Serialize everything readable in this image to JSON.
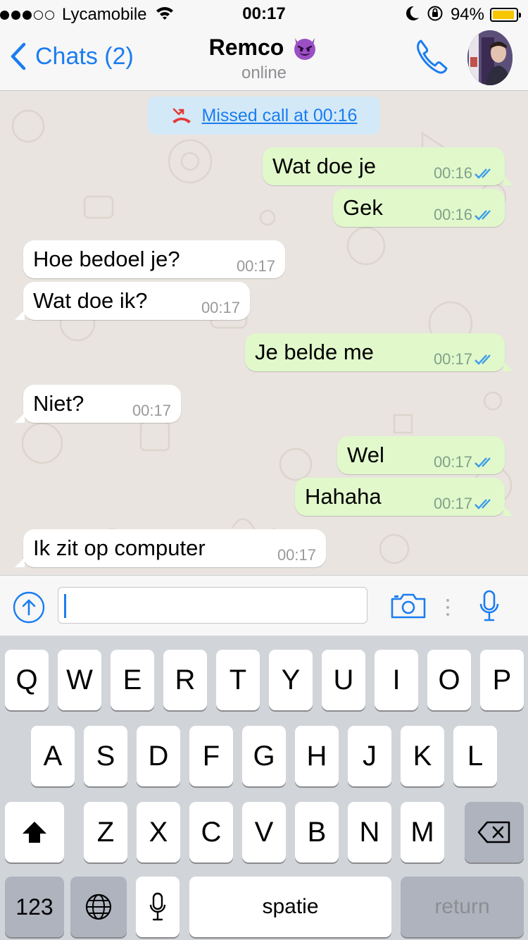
{
  "status_bar": {
    "carrier": "Lycamobile",
    "time": "00:17",
    "battery": "94%",
    "battery_level": 0.94,
    "signal_bars_filled": 3,
    "signal_bars_total": 5
  },
  "nav": {
    "back_label": "Chats (2)",
    "contact_name": "Remco",
    "status": "online"
  },
  "missed_call": "Missed call at 00:16",
  "messages": [
    {
      "dir": "out",
      "text": "Wat doe je",
      "time": "00:16"
    },
    {
      "dir": "out",
      "text": "Gek",
      "time": "00:16"
    },
    {
      "dir": "in",
      "text": "Hoe bedoel je?",
      "time": "00:17"
    },
    {
      "dir": "in",
      "text": "Wat doe ik?",
      "time": "00:17"
    },
    {
      "dir": "out",
      "text": "Je belde me",
      "time": "00:17"
    },
    {
      "dir": "in",
      "text": "Niet?",
      "time": "00:17"
    },
    {
      "dir": "out",
      "text": "Wel",
      "time": "00:17"
    },
    {
      "dir": "out",
      "text": "Hahaha",
      "time": "00:17"
    },
    {
      "dir": "in",
      "text": "Ik zit op computer",
      "time": "00:17"
    }
  ],
  "input": {
    "value": ""
  },
  "keyboard": {
    "row1": [
      "Q",
      "W",
      "E",
      "R",
      "T",
      "Y",
      "U",
      "I",
      "O",
      "P"
    ],
    "row2": [
      "A",
      "S",
      "D",
      "F",
      "G",
      "H",
      "J",
      "K",
      "L"
    ],
    "row3": [
      "Z",
      "X",
      "C",
      "V",
      "B",
      "N",
      "M"
    ],
    "numbers_label": "123",
    "space_label": "spatie",
    "return_label": "return"
  },
  "colors": {
    "accent": "#1a7df0",
    "outgoing_bubble": "#e1f8cb",
    "incoming_bubble": "#ffffff",
    "chat_background": "#e9e4df",
    "missed_call_icon": "#e53935"
  }
}
